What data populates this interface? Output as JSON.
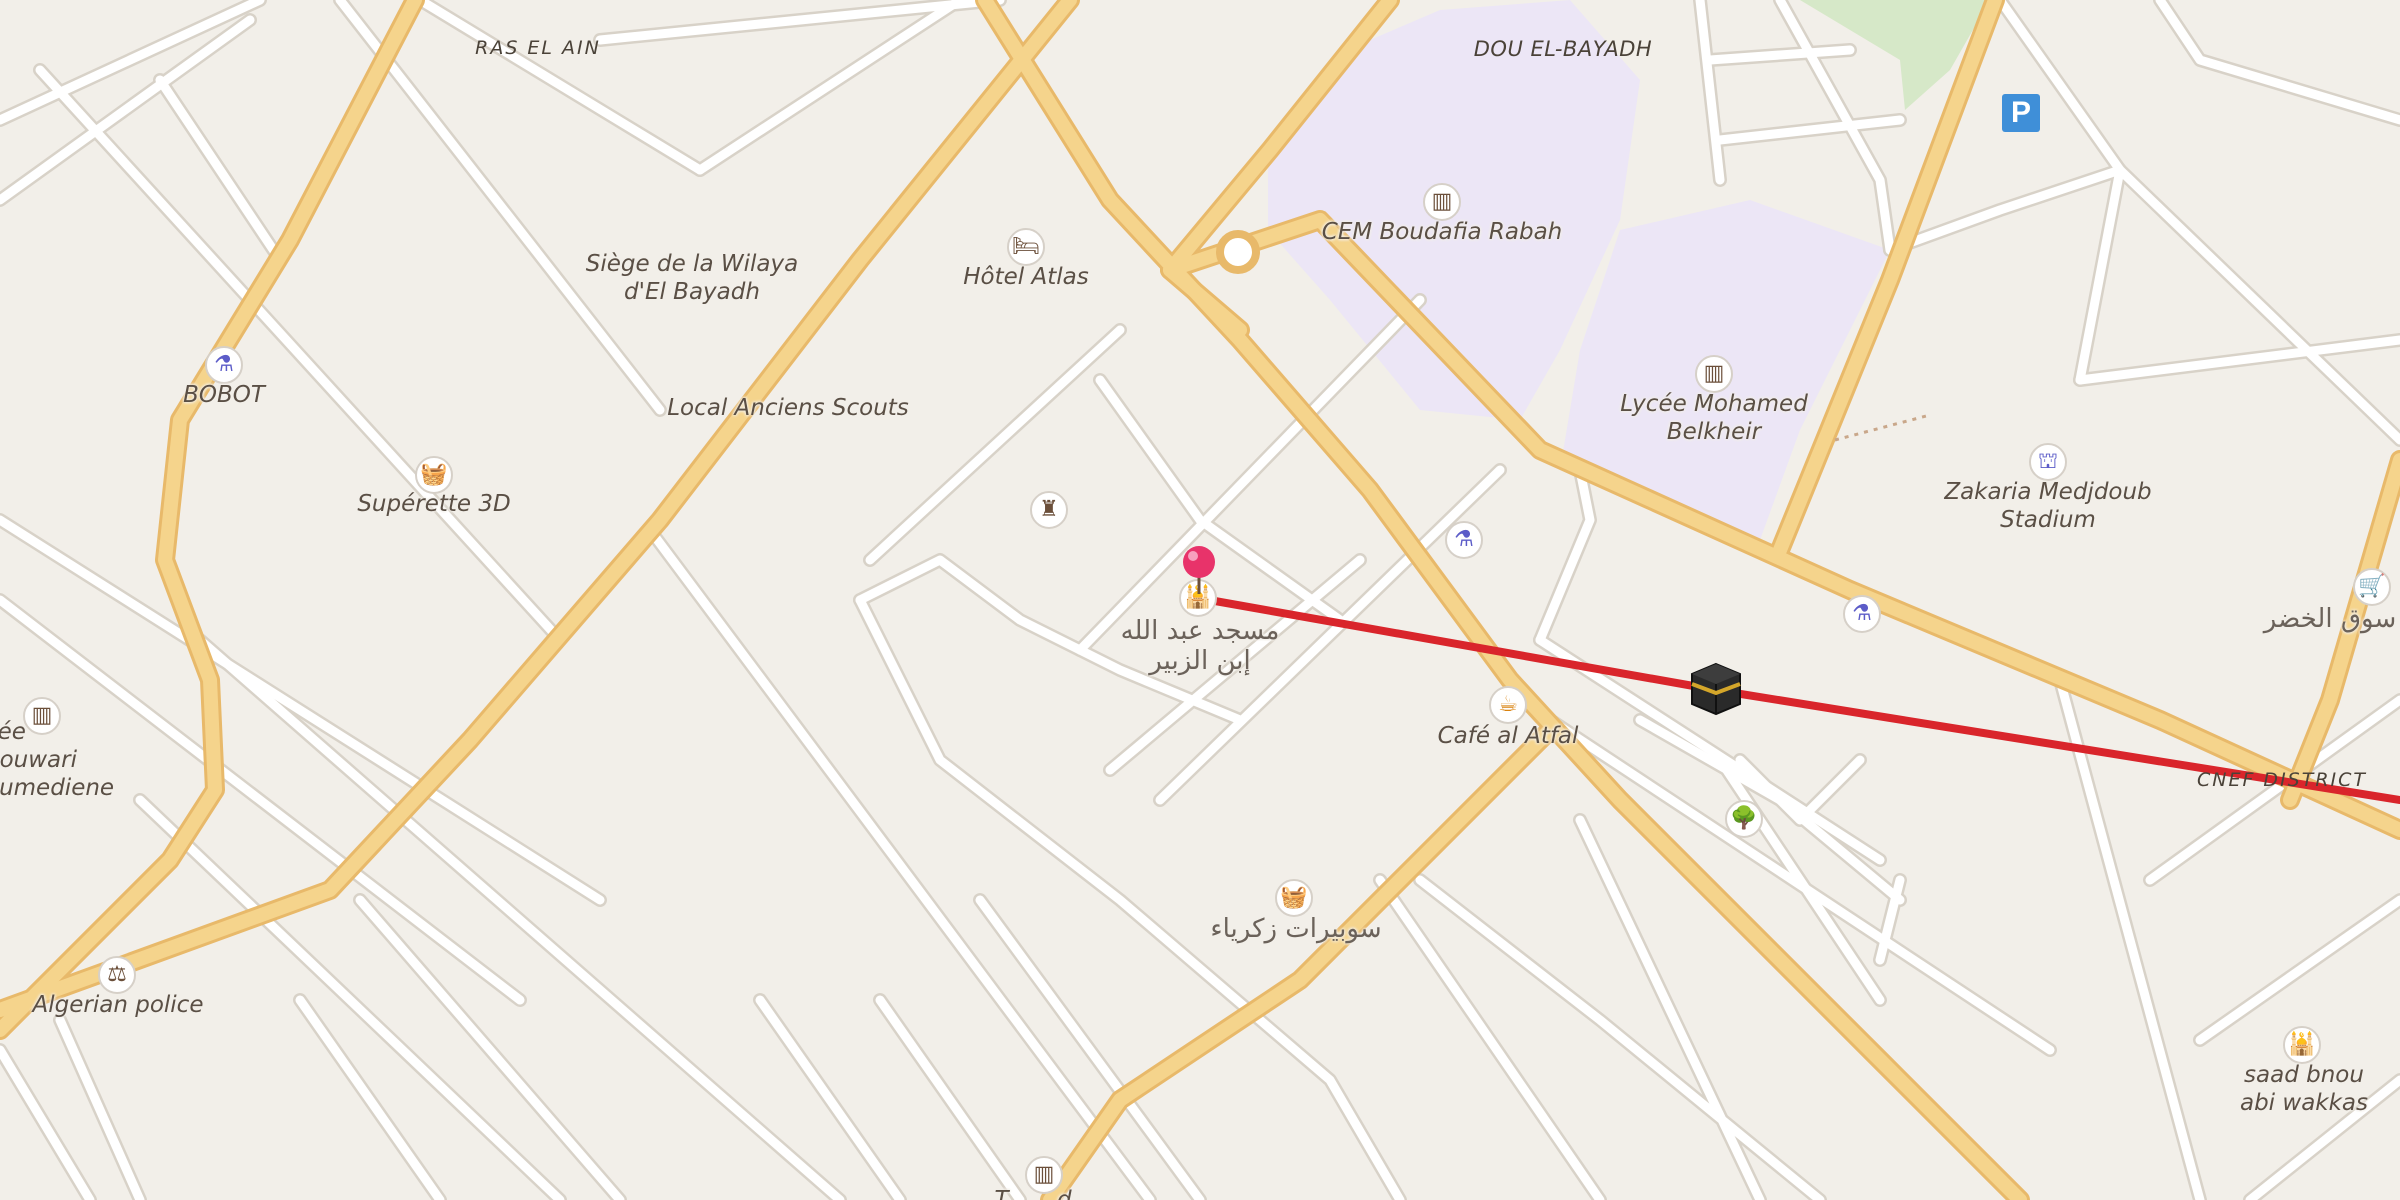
{
  "map": {
    "colors": {
      "background": "#f2efe9",
      "major_road": "#f5d48c",
      "major_road_casing": "#e8b96a",
      "minor_road": "#ffffff",
      "minor_road_casing": "#d8d2c8",
      "school_area": "#ece6f6",
      "park": "#d6e8c8",
      "route": "#d9252b",
      "marker": "#e8336a"
    },
    "districts": {
      "ras_el_ain": "RAS EL AIN",
      "dou_el_bayadh": "DOU EL-BAYADH",
      "cnef_district": "CNEF DISTRICT"
    },
    "pois": {
      "wilaya": "Siège de la Wilaya d'El Bayadh",
      "hotel": "Hôtel Atlas",
      "scouts": "Local Anciens Scouts",
      "bobot": "BOBOT",
      "superette": "Supérette 3D",
      "cem": "CEM Boudafia Rabah",
      "lycee_belkheir": "Lycée Mohamed Belkheir",
      "stadium": "Zakaria Medjdoub Stadium",
      "mosque": "مسجد عبد الله إبن الزبير",
      "cafe": "Café al Atfal",
      "souk": "سوق الخضر",
      "lycee_houari": "cée houwari oumediene",
      "police": "Algerian police",
      "superette_zakaria": "سوبيرات زكرياء",
      "saad": "saad bnou abi wakkas",
      "bottom_partial": "T... ...d..."
    },
    "icons": {
      "hotel": "bed-icon",
      "wilaya": "town-hall-icon",
      "pharmacy": "pharmacy-icon",
      "shop": "basket-icon",
      "school": "school-icon",
      "stadium": "stadium-icon",
      "mosque": "mosque-icon",
      "cafe": "cup-icon",
      "marketplace": "cart-icon",
      "police": "police-icon",
      "tree": "tree-icon",
      "parking": "parking-icon",
      "kaaba": "kaaba-icon",
      "marker": "map-pin-icon"
    },
    "parking_label": "P"
  }
}
